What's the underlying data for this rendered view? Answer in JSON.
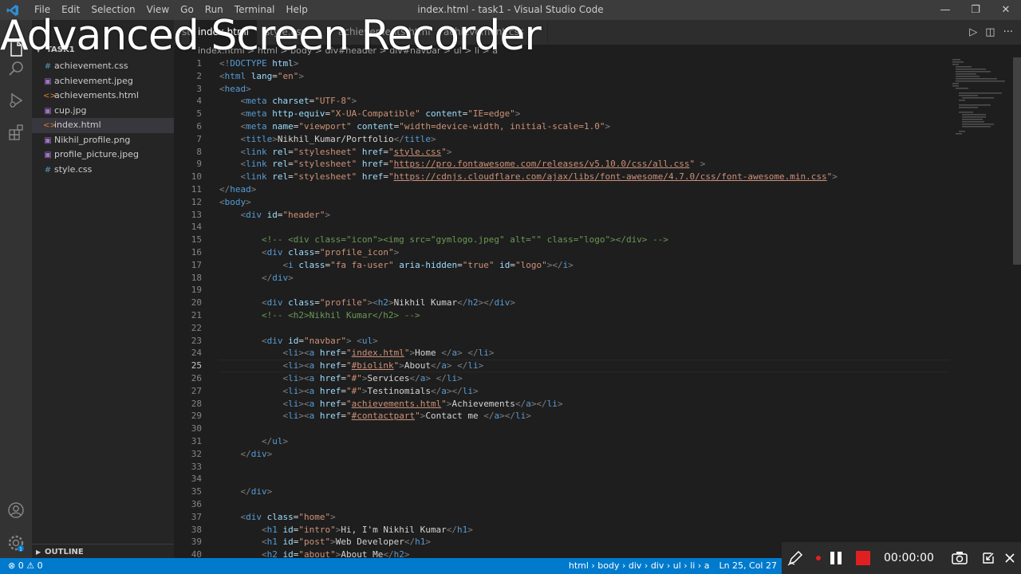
{
  "menu": [
    "File",
    "Edit",
    "Selection",
    "View",
    "Go",
    "Run",
    "Terminal",
    "Help"
  ],
  "window_title": "index.html - task1 - Visual Studio Code",
  "window_controls": {
    "minimize": "—",
    "maximize": "❐",
    "close": "✕"
  },
  "recorder": {
    "watermark": "Advanced Screen Recorder",
    "time": "00:00:00"
  },
  "tabs": [
    {
      "label": "index.html",
      "close": "✕"
    },
    {
      "label": "style.css"
    },
    {
      "label": "achievements.html"
    },
    {
      "label": "achievement.css"
    }
  ],
  "breadcrumb": "index.html > html > body > div#header > div#navbar > ul > li > a",
  "explorer": {
    "header": "TASK1",
    "files": [
      {
        "name": "achievement.css",
        "icon": "#",
        "color": "#519aba"
      },
      {
        "name": "achievement.jpeg",
        "icon": "▣",
        "color": "#a074c4"
      },
      {
        "name": "achievements.html",
        "icon": "<>",
        "color": "#e37933"
      },
      {
        "name": "cup.jpg",
        "icon": "▣",
        "color": "#a074c4"
      },
      {
        "name": "index.html",
        "icon": "<>",
        "color": "#e37933"
      },
      {
        "name": "Nikhil_profile.png",
        "icon": "▣",
        "color": "#a074c4"
      },
      {
        "name": "profile_picture.jpeg",
        "icon": "▣",
        "color": "#a074c4"
      },
      {
        "name": "style.css",
        "icon": "#",
        "color": "#519aba"
      }
    ],
    "outline_label": "OUTLINE"
  },
  "status": {
    "errors": "0",
    "warnings": "0",
    "path": "html › body › div › div › ul › li › a",
    "position": "Ln 25, Col 27"
  },
  "code_lines": [
    {
      "n": "1",
      "html": "<span class='t'>&lt;!</span><span class='tg'>DOCTYPE</span> <span class='at'>html</span><span class='t'>&gt;</span>"
    },
    {
      "n": "2",
      "html": "<span class='t'>&lt;</span><span class='tg'>html</span> <span class='at'>lang</span><span class='tx'>=</span><span class='st'>\"en\"</span><span class='t'>&gt;</span>"
    },
    {
      "n": "3",
      "html": "<span class='t'>&lt;</span><span class='tg'>head</span><span class='t'>&gt;</span>"
    },
    {
      "n": "4",
      "html": "    <span class='t'>&lt;</span><span class='tg'>meta</span> <span class='at'>charset</span><span class='tx'>=</span><span class='st'>\"UTF-8\"</span><span class='t'>&gt;</span>"
    },
    {
      "n": "5",
      "html": "    <span class='t'>&lt;</span><span class='tg'>meta</span> <span class='at'>http-equiv</span><span class='tx'>=</span><span class='st'>\"X-UA-Compatible\"</span> <span class='at'>content</span><span class='tx'>=</span><span class='st'>\"IE=edge\"</span><span class='t'>&gt;</span>"
    },
    {
      "n": "6",
      "html": "    <span class='t'>&lt;</span><span class='tg'>meta</span> <span class='at'>name</span><span class='tx'>=</span><span class='st'>\"viewport\"</span> <span class='at'>content</span><span class='tx'>=</span><span class='st'>\"width=device-width, initial-scale=1.0\"</span><span class='t'>&gt;</span>"
    },
    {
      "n": "7",
      "html": "    <span class='t'>&lt;</span><span class='tg'>title</span><span class='t'>&gt;</span><span class='tx'>Nikhil_Kumar/Portfolio</span><span class='t'>&lt;/</span><span class='tg'>title</span><span class='t'>&gt;</span>"
    },
    {
      "n": "8",
      "html": "    <span class='t'>&lt;</span><span class='tg'>link</span> <span class='at'>rel</span><span class='tx'>=</span><span class='st'>\"stylesheet\"</span> <span class='at'>href</span><span class='tx'>=</span><span class='st'>\"<span class='ul'>style.css</span>\"</span><span class='t'>&gt;</span>"
    },
    {
      "n": "9",
      "html": "    <span class='t'>&lt;</span><span class='tg'>link</span> <span class='at'>rel</span><span class='tx'>=</span><span class='st'>\"stylesheet\"</span> <span class='at'>href</span><span class='tx'>=</span><span class='st'>\"<span class='ul'>https://pro.fontawesome.com/releases/v5.10.0/css/all.css</span>\"</span> <span class='t'>&gt;</span>"
    },
    {
      "n": "10",
      "html": "    <span class='t'>&lt;</span><span class='tg'>link</span> <span class='at'>rel</span><span class='tx'>=</span><span class='st'>\"stylesheet\"</span> <span class='at'>href</span><span class='tx'>=</span><span class='st'>\"<span class='ul'>https://cdnjs.cloudflare.com/ajax/libs/font-awesome/4.7.0/css/font-awesome.min.css</span>\"</span><span class='t'>&gt;</span>"
    },
    {
      "n": "11",
      "html": "<span class='t'>&lt;/</span><span class='tg'>head</span><span class='t'>&gt;</span>"
    },
    {
      "n": "12",
      "html": "<span class='t'>&lt;</span><span class='tg'>body</span><span class='t'>&gt;</span>"
    },
    {
      "n": "13",
      "html": "    <span class='t'>&lt;</span><span class='tg'>div</span> <span class='at'>id</span><span class='tx'>=</span><span class='st'>\"header\"</span><span class='t'>&gt;</span>"
    },
    {
      "n": "14",
      "html": ""
    },
    {
      "n": "15",
      "html": "        <span class='cm'>&lt;!-- &lt;div class=\"icon\"&gt;&lt;img src=\"gymlogo.jpeg\" alt=\"\" class=\"logo\"&gt;&lt;/div&gt; --&gt;</span>"
    },
    {
      "n": "16",
      "html": "        <span class='t'>&lt;</span><span class='tg'>div</span> <span class='at'>class</span><span class='tx'>=</span><span class='st'>\"profile_icon\"</span><span class='t'>&gt;</span>"
    },
    {
      "n": "17",
      "html": "            <span class='t'>&lt;</span><span class='tg'>i</span> <span class='at'>class</span><span class='tx'>=</span><span class='st'>\"fa fa-user\"</span> <span class='at'>aria-hidden</span><span class='tx'>=</span><span class='st'>\"true\"</span> <span class='at'>id</span><span class='tx'>=</span><span class='st'>\"logo\"</span><span class='t'>&gt;&lt;/</span><span class='tg'>i</span><span class='t'>&gt;</span>"
    },
    {
      "n": "18",
      "html": "        <span class='t'>&lt;/</span><span class='tg'>div</span><span class='t'>&gt;</span>"
    },
    {
      "n": "19",
      "html": ""
    },
    {
      "n": "20",
      "html": "        <span class='t'>&lt;</span><span class='tg'>div</span> <span class='at'>class</span><span class='tx'>=</span><span class='st'>\"profile\"</span><span class='t'>&gt;&lt;</span><span class='tg'>h2</span><span class='t'>&gt;</span><span class='tx'>Nikhil Kumar</span><span class='t'>&lt;/</span><span class='tg'>h2</span><span class='t'>&gt;&lt;/</span><span class='tg'>div</span><span class='t'>&gt;</span>"
    },
    {
      "n": "21",
      "html": "        <span class='cm'>&lt;!-- &lt;h2&gt;Nikhil Kumar&lt;/h2&gt; --&gt;</span>"
    },
    {
      "n": "22",
      "html": ""
    },
    {
      "n": "23",
      "html": "        <span class='t'>&lt;</span><span class='tg'>div</span> <span class='at'>id</span><span class='tx'>=</span><span class='st'>\"navbar\"</span><span class='t'>&gt;</span> <span class='t'>&lt;</span><span class='tg'>ul</span><span class='t'>&gt;</span>"
    },
    {
      "n": "24",
      "html": "            <span class='t'>&lt;</span><span class='tg'>li</span><span class='t'>&gt;&lt;</span><span class='tg'>a</span> <span class='at'>href</span><span class='tx'>=</span><span class='st'>\"<span class='ul'>index.html</span>\"</span><span class='t'>&gt;</span><span class='tx'>Home </span><span class='t'>&lt;/</span><span class='tg'>a</span><span class='t'>&gt;</span> <span class='t'>&lt;/</span><span class='tg'>li</span><span class='t'>&gt;</span>"
    },
    {
      "n": "25",
      "html": "            <span class='t'>&lt;</span><span class='tg'>li</span><span class='t'>&gt;&lt;</span><span class='tg'>a</span> <span class='at'>href</span><span class='tx'>=</span><span class='st'>\"<span class='ul'>#biolink</span>\"</span><span class='t'>&gt;</span><span class='tx'>About</span><span class='t'>&lt;/</span><span class='tg'>a</span><span class='t'>&gt;</span> <span class='t'>&lt;/</span><span class='tg'>li</span><span class='t'>&gt;</span>"
    },
    {
      "n": "26",
      "html": "            <span class='t'>&lt;</span><span class='tg'>li</span><span class='t'>&gt;&lt;</span><span class='tg'>a</span> <span class='at'>href</span><span class='tx'>=</span><span class='st'>\"#\"</span><span class='t'>&gt;</span><span class='tx'>Services</span><span class='t'>&lt;/</span><span class='tg'>a</span><span class='t'>&gt;</span> <span class='t'>&lt;/</span><span class='tg'>li</span><span class='t'>&gt;</span>"
    },
    {
      "n": "27",
      "html": "            <span class='t'>&lt;</span><span class='tg'>li</span><span class='t'>&gt;&lt;</span><span class='tg'>a</span> <span class='at'>href</span><span class='tx'>=</span><span class='st'>\"#\"</span><span class='t'>&gt;</span><span class='tx'>Testinomials</span><span class='t'>&lt;/</span><span class='tg'>a</span><span class='t'>&gt;&lt;/</span><span class='tg'>li</span><span class='t'>&gt;</span>"
    },
    {
      "n": "28",
      "html": "            <span class='t'>&lt;</span><span class='tg'>li</span><span class='t'>&gt;&lt;</span><span class='tg'>a</span> <span class='at'>href</span><span class='tx'>=</span><span class='st'>\"<span class='ul'>achievements.html</span>\"</span><span class='t'>&gt;</span><span class='tx'>Achievements</span><span class='t'>&lt;/</span><span class='tg'>a</span><span class='t'>&gt;&lt;/</span><span class='tg'>li</span><span class='t'>&gt;</span>"
    },
    {
      "n": "29",
      "html": "            <span class='t'>&lt;</span><span class='tg'>li</span><span class='t'>&gt;&lt;</span><span class='tg'>a</span> <span class='at'>href</span><span class='tx'>=</span><span class='st'>\"<span class='ul'>#contactpart</span>\"</span><span class='t'>&gt;</span><span class='tx'>Contact me </span><span class='t'>&lt;/</span><span class='tg'>a</span><span class='t'>&gt;&lt;/</span><span class='tg'>li</span><span class='t'>&gt;</span>"
    },
    {
      "n": "30",
      "html": ""
    },
    {
      "n": "31",
      "html": "        <span class='t'>&lt;/</span><span class='tg'>ul</span><span class='t'>&gt;</span>"
    },
    {
      "n": "32",
      "html": "    <span class='t'>&lt;/</span><span class='tg'>div</span><span class='t'>&gt;</span>"
    },
    {
      "n": "33",
      "html": ""
    },
    {
      "n": "34",
      "html": ""
    },
    {
      "n": "35",
      "html": "    <span class='t'>&lt;/</span><span class='tg'>div</span><span class='t'>&gt;</span>"
    },
    {
      "n": "36",
      "html": ""
    },
    {
      "n": "37",
      "html": "    <span class='t'>&lt;</span><span class='tg'>div</span> <span class='at'>class</span><span class='tx'>=</span><span class='st'>\"home\"</span><span class='t'>&gt;</span>"
    },
    {
      "n": "38",
      "html": "        <span class='t'>&lt;</span><span class='tg'>h1</span> <span class='at'>id</span><span class='tx'>=</span><span class='st'>\"intro\"</span><span class='t'>&gt;</span><span class='tx'>Hi, I'm Nikhil Kumar</span><span class='t'>&lt;/</span><span class='tg'>h1</span><span class='t'>&gt;</span>"
    },
    {
      "n": "39",
      "html": "        <span class='t'>&lt;</span><span class='tg'>h1</span> <span class='at'>id</span><span class='tx'>=</span><span class='st'>\"post\"</span><span class='t'>&gt;</span><span class='tx'>Web Developer</span><span class='t'>&lt;/</span><span class='tg'>h1</span><span class='t'>&gt;</span>"
    },
    {
      "n": "40",
      "html": "        <span class='t'>&lt;</span><span class='tg'>h2</span> <span class='at'>id</span><span class='tx'>=</span><span class='st'>\"about\"</span><span class='t'>&gt;</span><span class='tx'>About Me</span><span class='t'>&lt;/</span><span class='tg'>h2</span><span class='t'>&gt;</span>"
    }
  ],
  "current_line": "25"
}
